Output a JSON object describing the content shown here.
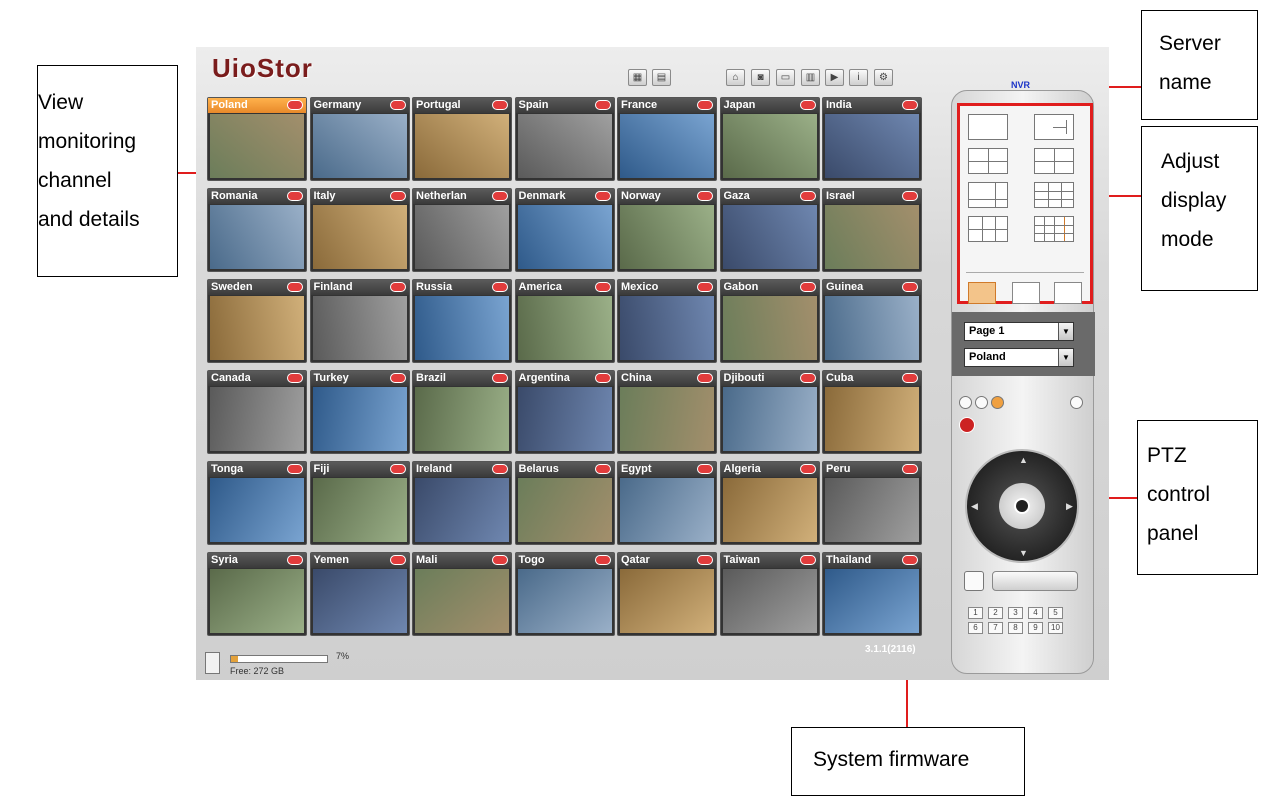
{
  "annotations": {
    "view_monitoring": [
      "View",
      "monitoring",
      "channel",
      "and details"
    ],
    "server_name": [
      "Server",
      "name"
    ],
    "adjust_display": [
      "Adjust",
      "display",
      "mode"
    ],
    "ptz_panel": [
      "PTZ",
      "control",
      "panel"
    ],
    "system_firmware": "System firmware"
  },
  "app": {
    "logo": "UioStor",
    "server": "NVR",
    "firmware": "3.1.1(2116)",
    "hdd": {
      "percent_label": "7%",
      "fill_fraction": 0.07,
      "free_label": "Free: 272 GB"
    },
    "selects": {
      "page": "Page 1",
      "channel": "Poland"
    },
    "presets": [
      "1",
      "2",
      "3",
      "4",
      "5",
      "6",
      "7",
      "8",
      "9",
      "10"
    ]
  },
  "cameras": [
    [
      "Poland",
      "Germany",
      "Portugal",
      "Spain",
      "France",
      "Japan",
      "India"
    ],
    [
      "Romania",
      "Italy",
      "Netherlan",
      "Denmark",
      "Norway",
      "Gaza",
      "Israel"
    ],
    [
      "Sweden",
      "Finland",
      "Russia",
      "America",
      "Mexico",
      "Gabon",
      "Guinea"
    ],
    [
      "Canada",
      "Turkey",
      "Brazil",
      "Argentina",
      "China",
      "Djibouti",
      "Cuba"
    ],
    [
      "Tonga",
      "Fiji",
      "Ireland",
      "Belarus",
      "Egypt",
      "Algeria",
      "Peru"
    ],
    [
      "Syria",
      "Yemen",
      "Mali",
      "Togo",
      "Qatar",
      "Taiwan",
      "Thailand"
    ]
  ],
  "colors": {
    "accent": "#e01d1d",
    "selected": "#f0a040",
    "server": "#1b34c8"
  }
}
